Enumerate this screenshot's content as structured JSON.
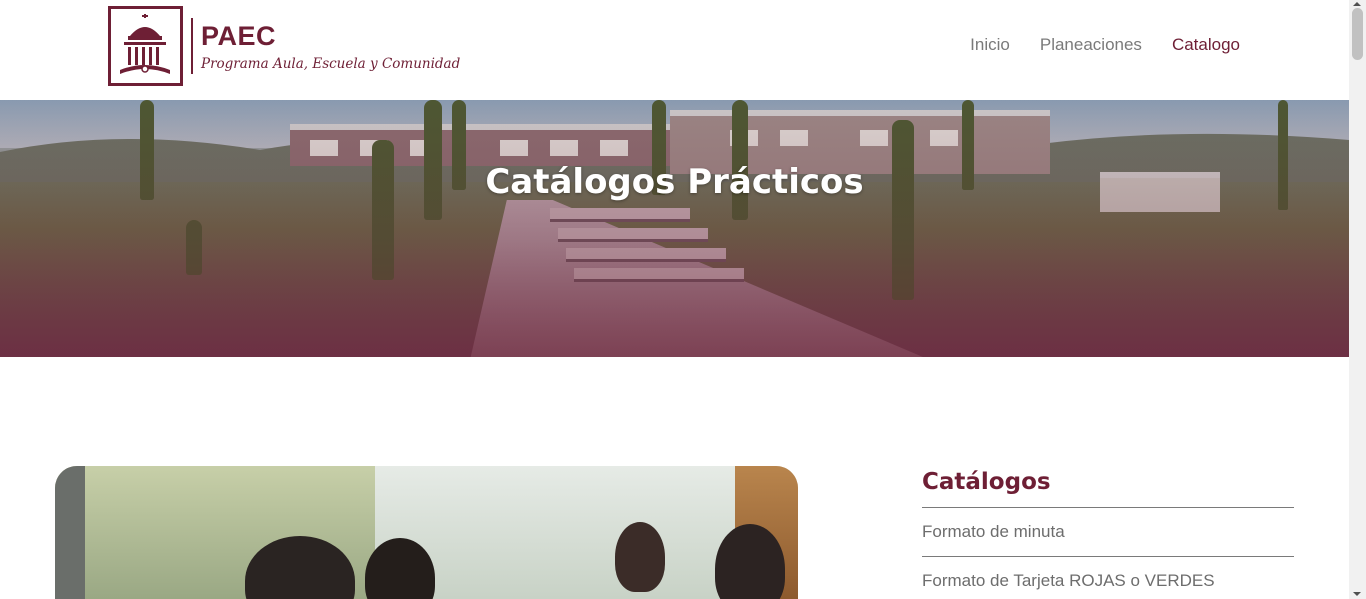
{
  "header": {
    "logo": {
      "title": "PAEC",
      "subtitle": "Programa Aula, Escuela y Comunidad",
      "icon": "building-dome-icon"
    },
    "nav": [
      {
        "label": "Inicio",
        "active": false
      },
      {
        "label": "Planeaciones",
        "active": false
      },
      {
        "label": "Catalogo",
        "active": true
      }
    ]
  },
  "hero": {
    "title": "Catálogos Prácticos"
  },
  "sidebar": {
    "title": "Catálogos",
    "items": [
      {
        "label": "Formato de minuta"
      },
      {
        "label": "Formato de Tarjeta ROJAS o VERDES"
      }
    ]
  },
  "colors": {
    "brand": "#6e1f35",
    "nav_text": "#7a7a7a",
    "body_text": "#6d6d6d"
  }
}
